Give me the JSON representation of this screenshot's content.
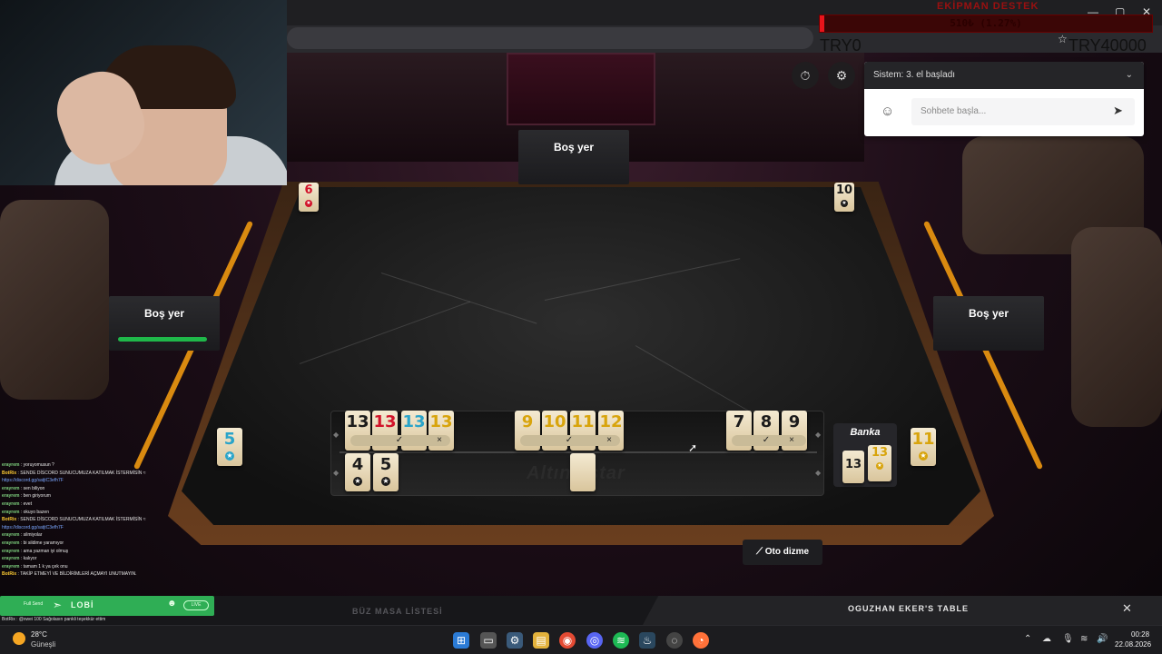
{
  "overlay": {
    "title": "EKİPMAN DESTEK",
    "progress_text": "510₺ (1.27%)",
    "progress_fraction": 0.0127,
    "left_amount": "TRY0",
    "right_amount": "TRY40000"
  },
  "seats": {
    "top": "Boş yer",
    "left": "Boş yer",
    "right": "Boş yer"
  },
  "indicators": {
    "top_left_tile": {
      "value": "6",
      "color": "red"
    },
    "top_right_tile": {
      "value": "10",
      "color": "black"
    },
    "left_discard_tile": {
      "value": "5",
      "color": "blue"
    },
    "right_discard_tile": {
      "value": "11",
      "color": "yellow"
    }
  },
  "rack": {
    "logo": "Altıncıstar",
    "groups": [
      {
        "tiles": [
          {
            "value": "13",
            "color": "black"
          },
          {
            "value": "13",
            "color": "red"
          },
          {
            "value": "13",
            "color": "blue"
          },
          {
            "value": "13",
            "color": "yellow"
          }
        ]
      },
      {
        "tiles": [
          {
            "value": "9",
            "color": "yellow"
          },
          {
            "value": "10",
            "color": "yellow"
          },
          {
            "value": "11",
            "color": "yellow"
          },
          {
            "value": "12",
            "color": "yellow"
          }
        ]
      },
      {
        "tiles": [
          {
            "value": "7",
            "color": "black"
          },
          {
            "value": "8",
            "color": "black"
          },
          {
            "value": "9",
            "color": "black"
          }
        ]
      }
    ],
    "bottom_row": [
      {
        "value": "4",
        "color": "black"
      },
      {
        "value": "5",
        "color": "black"
      }
    ],
    "confirm_glyph": "✓",
    "reject_glyph": "×"
  },
  "bank": {
    "label": "Banka",
    "tiles": [
      {
        "value": "13",
        "color": "black"
      },
      {
        "value": "13",
        "color": "yellow"
      }
    ]
  },
  "auto_arrange_label": "Oto dizme",
  "chat": {
    "system_message": "Sistem: 3. el başladı",
    "placeholder": "Sohbete başla..."
  },
  "stream_chat": [
    {
      "user": "erayrem",
      "text": "yoruyomusun ?"
    },
    {
      "user": "BotRix",
      "text": "SENDE DİSCORD SUNUCUMUZA KATILMAK İSTERMİSİN ≈",
      "bot": true
    },
    {
      "user": "",
      "text": "https://discord.gg/satjtC3efh7F",
      "link": true
    },
    {
      "user": "erayrem",
      "text": "sen biliyon"
    },
    {
      "user": "erayrem",
      "text": "ben giriyorum"
    },
    {
      "user": "erayrem",
      "text": "evet"
    },
    {
      "user": "erayrem",
      "text": "okuyo bazen"
    },
    {
      "user": "BotRix",
      "text": "SENDE DİSCORD SUNUCUMUZA KATILMAK İSTERMİSİN ≈",
      "bot": true
    },
    {
      "user": "",
      "text": "https://discord.gg/satjtC3efh7F",
      "link": true
    },
    {
      "user": "erayrem",
      "text": "silmiyolar"
    },
    {
      "user": "erayrem",
      "text": "bi sildime yaramıyor"
    },
    {
      "user": "erayrem",
      "text": "ama yazman iyi olmuş"
    },
    {
      "user": "erayrem",
      "text": "kalıyor"
    },
    {
      "user": "erayrem",
      "text": "tamam 1 k ya çek onu"
    },
    {
      "user": "BotRix",
      "text": "TAKİP ETMEYİ VE BİLDİRİMLERİ AÇMAYI UNUTMAYIN.",
      "bot": true
    }
  ],
  "lobi": {
    "label": "LOBİ",
    "small_text": "Full Send",
    "pill": "LIVE"
  },
  "ticker": "BotRix : @xwei 100 Sağolasın pankli teşekkür ettim",
  "bottom": {
    "list_link": "BÜZ MASA LİSTESİ",
    "table_name": "OGUZHAN EKER'S TABLE"
  },
  "taskbar": {
    "temp": "28°C",
    "weather": "Güneşli",
    "time": "00:28",
    "date": "22.08.2026"
  },
  "colors": {
    "red": "#d1132a",
    "blue": "#2aa4c9",
    "yellow": "#d8a40c",
    "black": "#1b1b1b",
    "timer_green": "#1fb84a",
    "progress_red": "#e8141b"
  }
}
